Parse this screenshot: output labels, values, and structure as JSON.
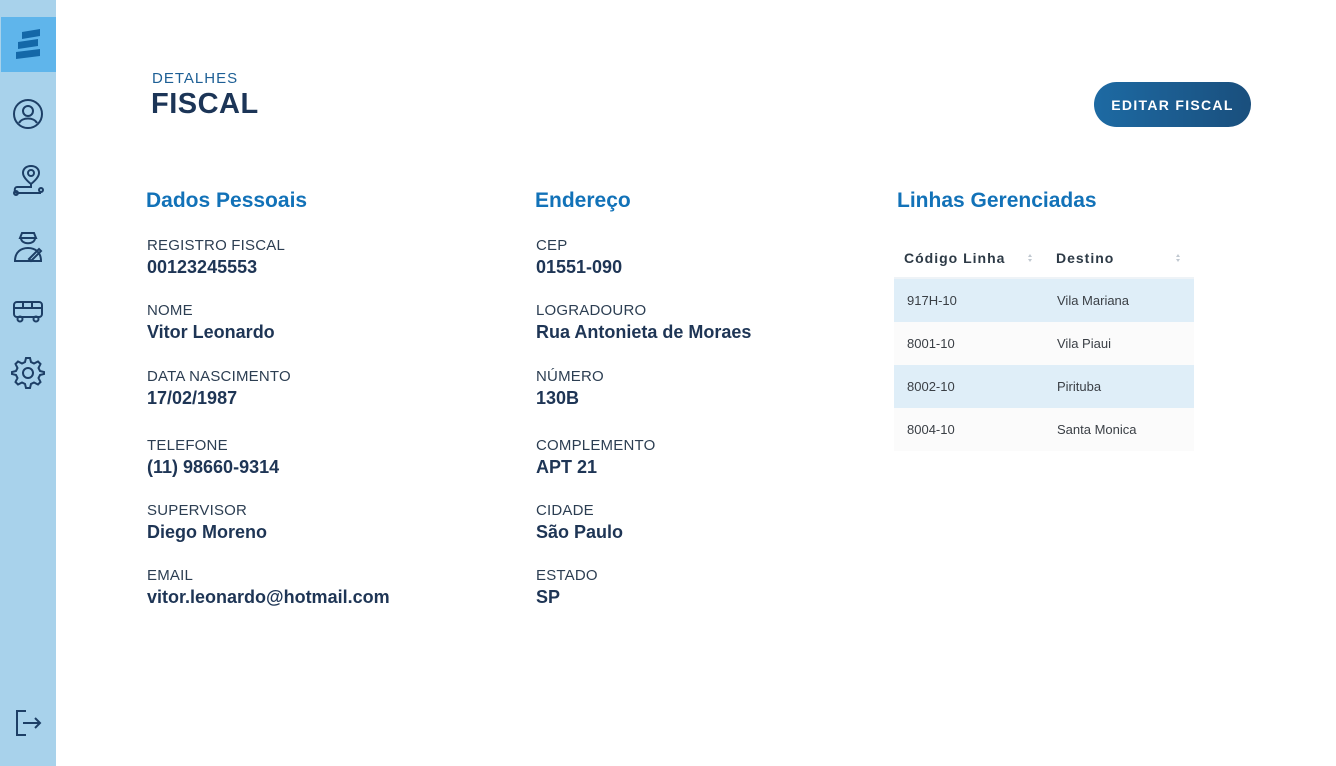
{
  "header": {
    "eyebrow": "DETALHES",
    "title": "FISCAL",
    "edit_button": "EDITAR FISCAL"
  },
  "sidebar": {
    "icons": [
      "logo-icon",
      "user-circle-icon",
      "route-pin-icon",
      "inspector-icon",
      "bus-icon",
      "gear-icon",
      "logout-icon"
    ]
  },
  "personal": {
    "title": "Dados Pessoais",
    "fields": [
      {
        "label": "REGISTRO FISCAL",
        "value": "00123245553"
      },
      {
        "label": "NOME",
        "value": "Vitor Leonardo"
      },
      {
        "label": "DATA NASCIMENTO",
        "value": "17/02/1987"
      },
      {
        "label": "TELEFONE",
        "value": "(11) 98660-9314"
      },
      {
        "label": "SUPERVISOR",
        "value": "Diego Moreno"
      },
      {
        "label": "EMAIL",
        "value": "vitor.leonardo@hotmail.com"
      }
    ]
  },
  "address": {
    "title": "Endereço",
    "fields": [
      {
        "label": "CEP",
        "value": "01551-090"
      },
      {
        "label": "LOGRADOURO",
        "value": "Rua Antonieta de Moraes"
      },
      {
        "label": "NÚMERO",
        "value": "130B"
      },
      {
        "label": "COMPLEMENTO",
        "value": "APT 21"
      },
      {
        "label": "CIDADE",
        "value": "São Paulo"
      },
      {
        "label": "ESTADO",
        "value": "SP"
      }
    ]
  },
  "lines": {
    "title": "Linhas Gerenciadas",
    "columns": [
      "Código Linha",
      "Destino"
    ],
    "rows": [
      {
        "code": "917H-10",
        "dest": "Vila Mariana"
      },
      {
        "code": "8001-10",
        "dest": "Vila Piaui"
      },
      {
        "code": "8002-10",
        "dest": "Pirituba"
      },
      {
        "code": "8004-10",
        "dest": "Santa Monica"
      }
    ]
  },
  "colors": {
    "sidebar": "#a8d2eb",
    "sidebar_active": "#5fb5eb",
    "accent": "#1272b8",
    "button": "#1a5a8c"
  }
}
